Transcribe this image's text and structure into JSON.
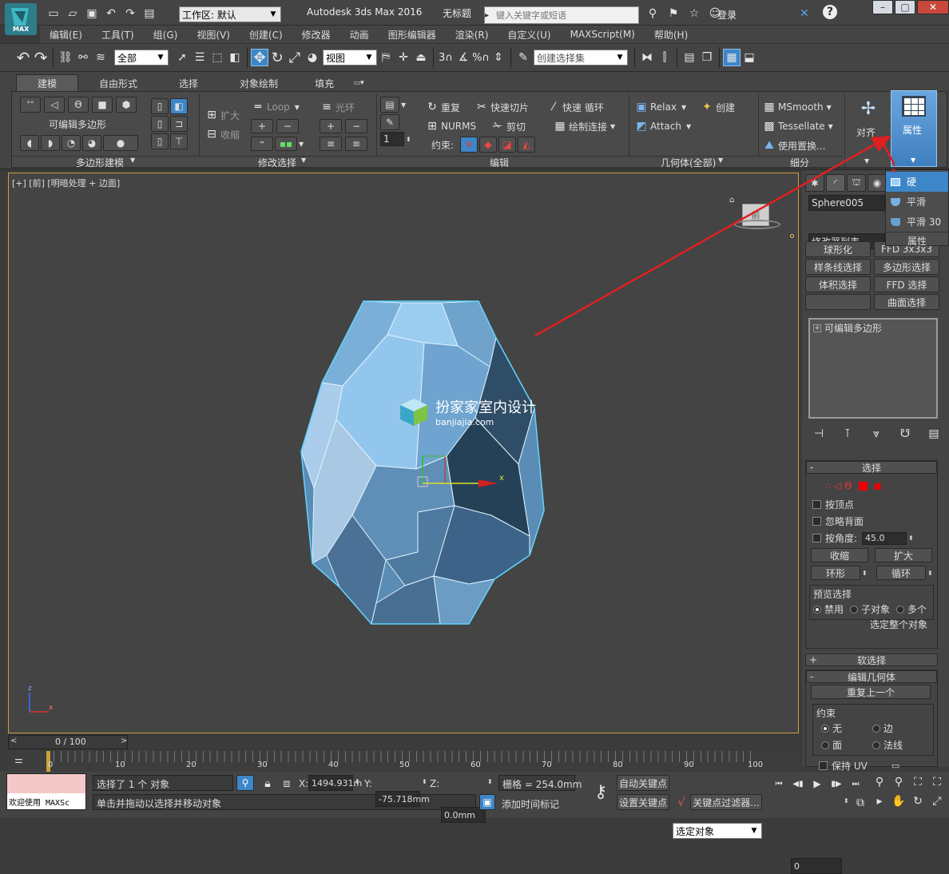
{
  "titlebar": {
    "app_logo": "MAX",
    "workspace_label": "工作区: 默认",
    "title": "Autodesk 3ds Max 2016",
    "document": "无标题",
    "search_placeholder": "键入关键字或短语",
    "login": "登录"
  },
  "menu": [
    "编辑(E)",
    "工具(T)",
    "组(G)",
    "视图(V)",
    "创建(C)",
    "修改器",
    "动画",
    "图形编辑器",
    "渲染(R)",
    "自定义(U)",
    "MAXScript(M)",
    "帮助(H)"
  ],
  "toolbar": {
    "selection_filter": "全部",
    "view_dropdown": "视图",
    "snap_labels": [
      "3",
      "%"
    ],
    "selection_set_placeholder": "创建选择集"
  },
  "ribbon": {
    "tabs": [
      "建模",
      "自由形式",
      "选择",
      "对象绘制",
      "填充"
    ],
    "active_tab": "建模",
    "editable_poly_label": "可编辑多边形",
    "polygon_modeling": "多边形建模",
    "expand": "扩大",
    "shrink": "收缩",
    "loop": "Loop",
    "ring": "光环",
    "modify_selection": "修改选择",
    "spinner_value": "1",
    "repeat": "重复",
    "quick_slice": "快速切片",
    "quick_loop": "快速 循环",
    "nurms": "NURMS",
    "cut": "剪切",
    "swift_loop": "绘制连接",
    "constraint": "约束:",
    "edit": "编辑",
    "relax": "Relax",
    "create": "创建",
    "attach": "Attach",
    "geometry_all": "几何体(全部)",
    "msmooth": "MSmooth",
    "tessellate": "Tessellate",
    "use_displace": "使用置换...",
    "subdivision": "细分",
    "align": "对齐",
    "properties": "属性"
  },
  "properties_menu": {
    "items": [
      "硬",
      "平滑",
      "平滑 30"
    ],
    "footer": "属性"
  },
  "viewport": {
    "label": "[+] [前] [明暗处理 + 边面]",
    "watermark_title": "扮家家室内设计",
    "watermark_url": "banjiajia.com",
    "gizmo_x": "x",
    "nav_cube_label": "前",
    "axis_z": "z",
    "axis_x": "x"
  },
  "cmd_panel": {
    "object_name": "Sphere005",
    "modifier_list": "修改器列表",
    "mod_buttons": [
      "球形化",
      "FFD 3x3x3",
      "样条线选择",
      "多边形选择",
      "体积选择",
      "FFD 选择",
      "",
      "曲面选择"
    ],
    "stack_item": "可编辑多边形",
    "selection_title": "选择",
    "by_vertex": "按顶点",
    "ignore_backfacing": "忽略背面",
    "by_angle": "按角度:",
    "angle_value": "45.0",
    "shrink": "收缩",
    "grow": "扩大",
    "ring": "环形",
    "loop": "循环",
    "preview_selection": "预览选择",
    "preview_opts": [
      "禁用",
      "子对象",
      "多个"
    ],
    "select_whole": "选定整个对象",
    "soft_selection": "软选择",
    "edit_geometry": "编辑几何体",
    "repeat_last": "重复上一个",
    "constraints": "约束",
    "constraint_opts": [
      "无",
      "边",
      "面",
      "法线"
    ],
    "preserve_uv": "保持 UV"
  },
  "timeline": {
    "frame_counter": "0 / 100",
    "ticks": [
      "0",
      "10",
      "20",
      "30",
      "40",
      "50",
      "60",
      "70",
      "80",
      "90",
      "100"
    ]
  },
  "status": {
    "welcome": "欢迎使用 MAXSc",
    "selected": "选择了 1 个 对象",
    "hint": "单击并拖动以选择并移动对象",
    "x_label": "X:",
    "x_value": "1494.931m",
    "y_label": "Y:",
    "y_value": "-75.718mm",
    "z_label": "Z:",
    "z_value": "0.0mm",
    "grid": "栅格 = 254.0mm",
    "add_time_tag": "添加时间标记",
    "auto_key": "自动关键点",
    "set_key": "设置关键点",
    "selected_object": "选定对象",
    "key_filters": "关键点过滤器...",
    "frame_value": "0"
  },
  "colors": {
    "accent_blue": "#4a86c8",
    "red_arrow": "#e02020"
  }
}
